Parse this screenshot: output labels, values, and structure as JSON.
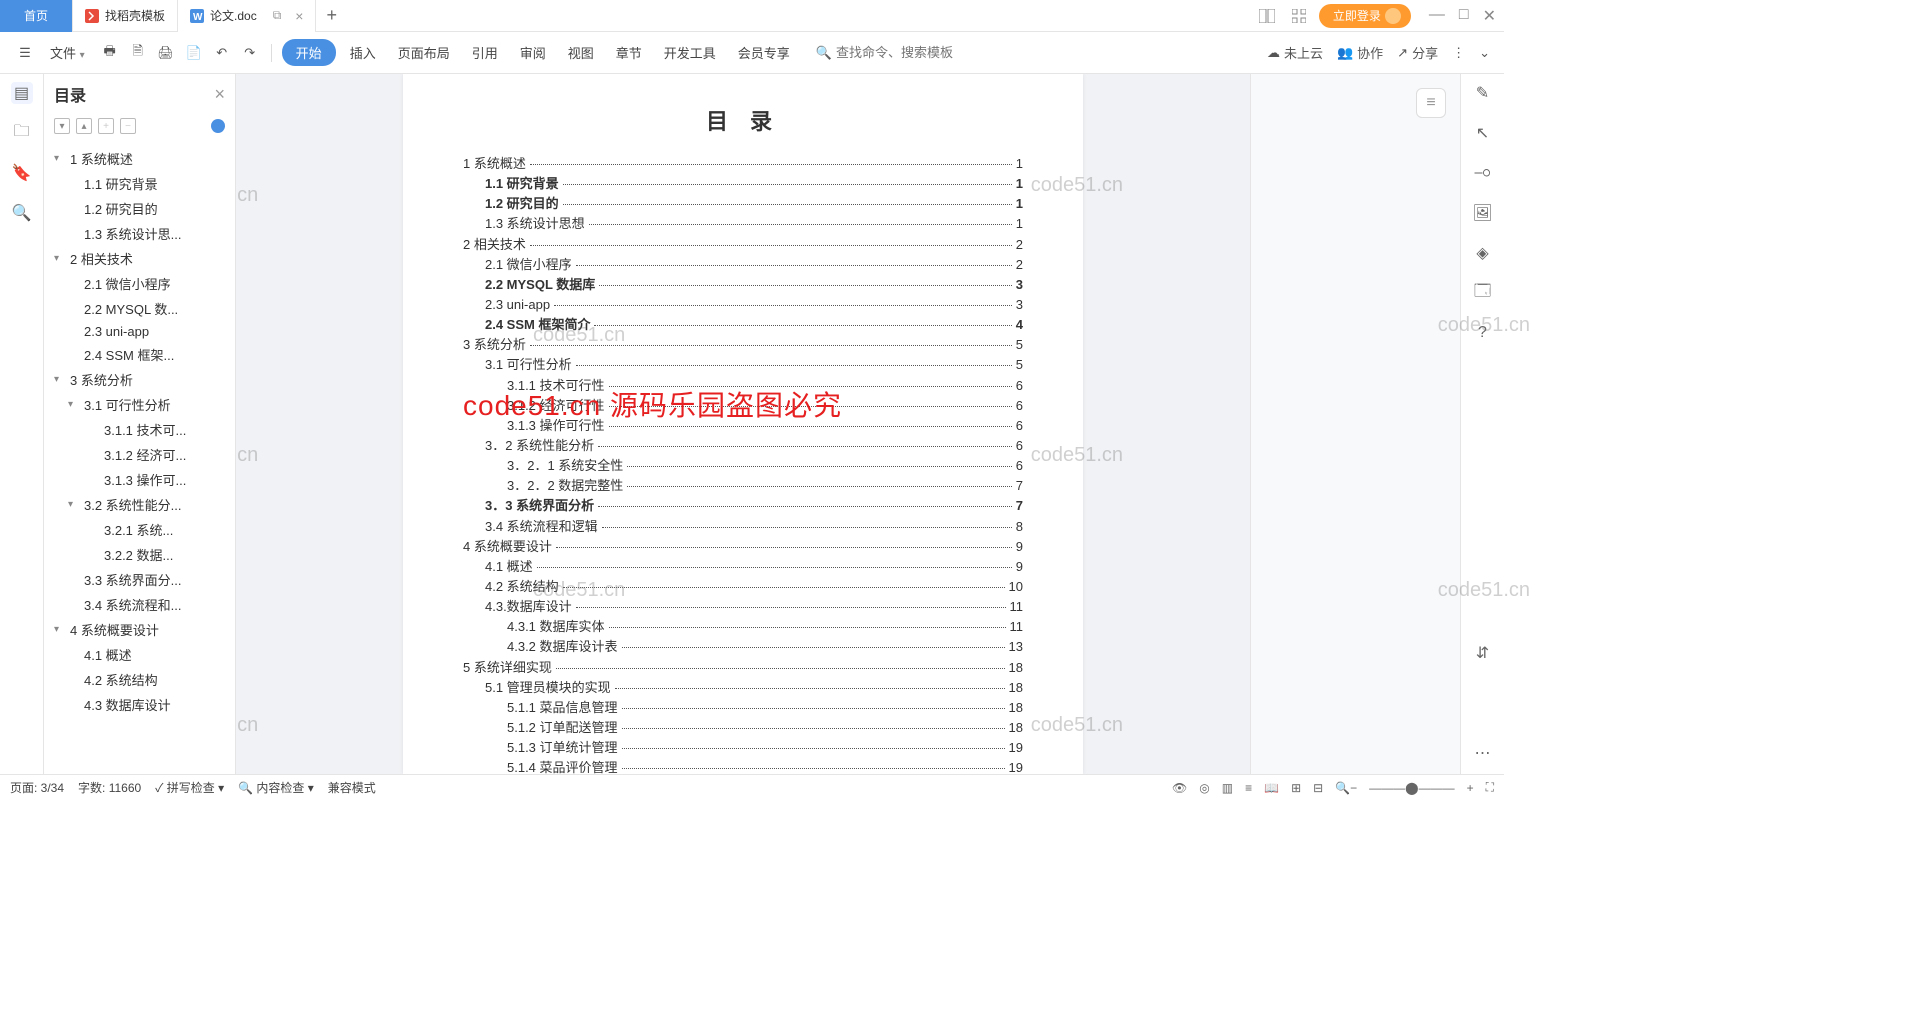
{
  "tabs": {
    "home": "首页",
    "t1": "找稻壳模板",
    "t2": "论文.doc"
  },
  "login": "立即登录",
  "toolbar": {
    "file": "文件",
    "start": "开始",
    "insert": "插入",
    "layout": "页面布局",
    "ref": "引用",
    "review": "审阅",
    "view": "视图",
    "chapter": "章节",
    "dev": "开发工具",
    "member": "会员专享"
  },
  "search_ph": "查找命令、搜索模板",
  "cloud": "未上云",
  "collab": "协作",
  "share": "分享",
  "nav": {
    "title": "目录",
    "close": "×"
  },
  "tree": [
    {
      "lvl": 0,
      "chev": "▾",
      "txt": "1 系统概述"
    },
    {
      "lvl": 1,
      "txt": "1.1 研究背景"
    },
    {
      "lvl": 1,
      "txt": "1.2 研究目的"
    },
    {
      "lvl": 1,
      "txt": "1.3 系统设计思..."
    },
    {
      "lvl": 0,
      "chev": "▾",
      "txt": "2 相关技术"
    },
    {
      "lvl": 1,
      "txt": "2.1 微信小程序"
    },
    {
      "lvl": 1,
      "txt": "2.2 MYSQL 数..."
    },
    {
      "lvl": 1,
      "txt": "2.3 uni-app"
    },
    {
      "lvl": 1,
      "txt": "2.4 SSM 框架..."
    },
    {
      "lvl": 0,
      "chev": "▾",
      "txt": "3 系统分析"
    },
    {
      "lvl": 1,
      "chev": "▾",
      "txt": "3.1 可行性分析"
    },
    {
      "lvl": 2,
      "txt": "3.1.1 技术可..."
    },
    {
      "lvl": 2,
      "txt": "3.1.2 经济可..."
    },
    {
      "lvl": 2,
      "txt": "3.1.3 操作可..."
    },
    {
      "lvl": 1,
      "chev": "▾",
      "txt": "3.2 系统性能分..."
    },
    {
      "lvl": 2,
      "txt": "3.2.1  系统..."
    },
    {
      "lvl": 2,
      "txt": "3.2.2  数据..."
    },
    {
      "lvl": 1,
      "txt": "3.3 系统界面分..."
    },
    {
      "lvl": 1,
      "txt": "3.4 系统流程和..."
    },
    {
      "lvl": 0,
      "chev": "▾",
      "txt": "4 系统概要设计"
    },
    {
      "lvl": 1,
      "txt": "4.1 概述"
    },
    {
      "lvl": 1,
      "txt": "4.2 系统结构"
    },
    {
      "lvl": 1,
      "txt": "4.3 数据库设计"
    }
  ],
  "doc": {
    "title": "目 录"
  },
  "toc": [
    {
      "l": 1,
      "b": 0,
      "t": "1 系统概述",
      "p": "1"
    },
    {
      "l": 2,
      "b": 1,
      "t": "1.1 研究背景",
      "p": "1"
    },
    {
      "l": 2,
      "b": 1,
      "t": "1.2 研究目的",
      "p": "1"
    },
    {
      "l": 2,
      "b": 0,
      "t": "1.3 系统设计思想",
      "p": "1"
    },
    {
      "l": 1,
      "b": 0,
      "t": "2 相关技术",
      "p": "2"
    },
    {
      "l": 2,
      "b": 0,
      "t": "2.1 微信小程序",
      "p": "2"
    },
    {
      "l": 2,
      "b": 1,
      "t": "2.2 MYSQL 数据库",
      "p": "3"
    },
    {
      "l": 2,
      "b": 0,
      "t": "2.3 uni-app",
      "p": "3"
    },
    {
      "l": 2,
      "b": 1,
      "t": "2.4 SSM 框架简介",
      "p": "4"
    },
    {
      "l": 1,
      "b": 0,
      "t": "3 系统分析",
      "p": "5"
    },
    {
      "l": 2,
      "b": 0,
      "t": "3.1 可行性分析",
      "p": "5"
    },
    {
      "l": 3,
      "b": 0,
      "t": "3.1.1 技术可行性",
      "p": "6"
    },
    {
      "l": 3,
      "b": 0,
      "t": "3.1.2 经济可行性",
      "p": "6"
    },
    {
      "l": 3,
      "b": 0,
      "t": "3.1.3 操作可行性",
      "p": "6"
    },
    {
      "l": 2,
      "b": 0,
      "t": "3．2 系统性能分析",
      "p": "6"
    },
    {
      "l": 3,
      "b": 0,
      "t": "3．2．1  系统安全性",
      "p": "6"
    },
    {
      "l": 3,
      "b": 0,
      "t": "3．2．2  数据完整性",
      "p": "7"
    },
    {
      "l": 2,
      "b": 1,
      "t": "3．3 系统界面分析",
      "p": "7"
    },
    {
      "l": 2,
      "b": 0,
      "t": "3.4 系统流程和逻辑",
      "p": "8"
    },
    {
      "l": 1,
      "b": 0,
      "t": "4 系统概要设计",
      "p": "9"
    },
    {
      "l": 2,
      "b": 0,
      "t": "4.1 概述",
      "p": "9"
    },
    {
      "l": 2,
      "b": 0,
      "t": "4.2 系统结构",
      "p": "10"
    },
    {
      "l": 2,
      "b": 0,
      "t": "4.3.数据库设计",
      "p": "11"
    },
    {
      "l": 3,
      "b": 0,
      "t": "4.3.1 数据库实体",
      "p": "11"
    },
    {
      "l": 3,
      "b": 0,
      "t": "4.3.2 数据库设计表",
      "p": "13"
    },
    {
      "l": 1,
      "b": 0,
      "t": "5 系统详细实现",
      "p": "18"
    },
    {
      "l": 2,
      "b": 0,
      "t": "5.1 管理员模块的实现",
      "p": "18"
    },
    {
      "l": 3,
      "b": 0,
      "t": "5.1.1 菜品信息管理",
      "p": "18"
    },
    {
      "l": 3,
      "b": 0,
      "t": "5.1.2 订单配送管理",
      "p": "18"
    },
    {
      "l": 3,
      "b": 0,
      "t": "5.1.3 订单统计管理",
      "p": "19"
    },
    {
      "l": 3,
      "b": 0,
      "t": "5.1.4 菜品评价管理",
      "p": "19"
    }
  ],
  "redmark": "code51.cn 源码乐园盗图必究",
  "wm": "code51.cn",
  "status": {
    "page": "页面: 3/34",
    "words": "字数: 11660",
    "spell": "拼写检查",
    "content": "内容检查",
    "compat": "兼容模式"
  }
}
